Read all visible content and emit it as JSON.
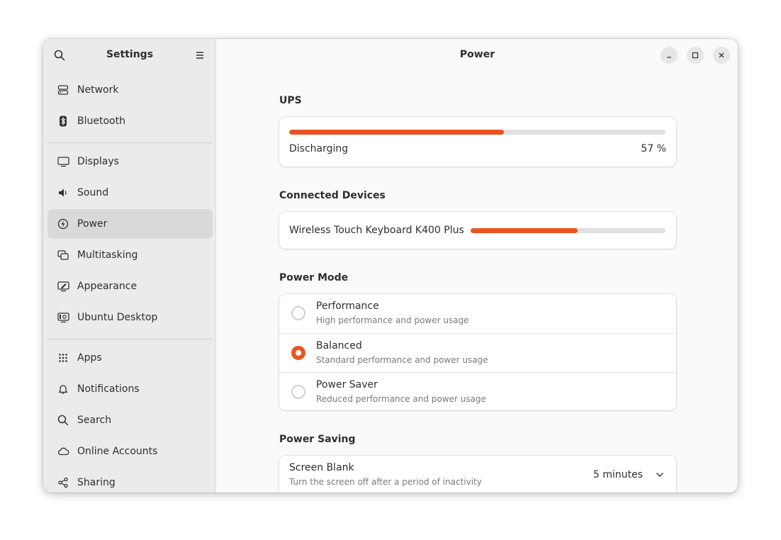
{
  "sidebar": {
    "title": "Settings",
    "items": [
      {
        "label": "Network",
        "icon": "network-icon"
      },
      {
        "label": "Bluetooth",
        "icon": "bluetooth-icon"
      },
      {
        "label": "Displays",
        "icon": "display-icon"
      },
      {
        "label": "Sound",
        "icon": "speaker-icon"
      },
      {
        "label": "Power",
        "icon": "power-icon",
        "active": true
      },
      {
        "label": "Multitasking",
        "icon": "multitasking-icon"
      },
      {
        "label": "Appearance",
        "icon": "appearance-icon"
      },
      {
        "label": "Ubuntu Desktop",
        "icon": "ubuntu-desktop-icon"
      },
      {
        "label": "Apps",
        "icon": "apps-grid-icon"
      },
      {
        "label": "Notifications",
        "icon": "bell-icon"
      },
      {
        "label": "Search",
        "icon": "search-icon"
      },
      {
        "label": "Online Accounts",
        "icon": "cloud-icon"
      },
      {
        "label": "Sharing",
        "icon": "share-icon"
      }
    ]
  },
  "main": {
    "title": "Power",
    "ups": {
      "section": "UPS",
      "status": "Discharging",
      "percent_label": "57 %",
      "level": 0.57
    },
    "connected": {
      "section": "Connected Devices",
      "device": "Wireless Touch Keyboard K400 Plus",
      "level": 0.55
    },
    "power_mode": {
      "section": "Power Mode",
      "options": [
        {
          "label": "Performance",
          "desc": "High performance and power usage",
          "selected": false
        },
        {
          "label": "Balanced",
          "desc": "Standard performance and power usage",
          "selected": true
        },
        {
          "label": "Power Saver",
          "desc": "Reduced performance and power usage",
          "selected": false
        }
      ]
    },
    "power_saving": {
      "section": "Power Saving",
      "screen_blank": {
        "label": "Screen Blank",
        "desc": "Turn the screen off after a period of inactivity",
        "value": "5 minutes"
      }
    }
  },
  "colors": {
    "accent": "#e95420",
    "track": "#e0e0e0"
  }
}
